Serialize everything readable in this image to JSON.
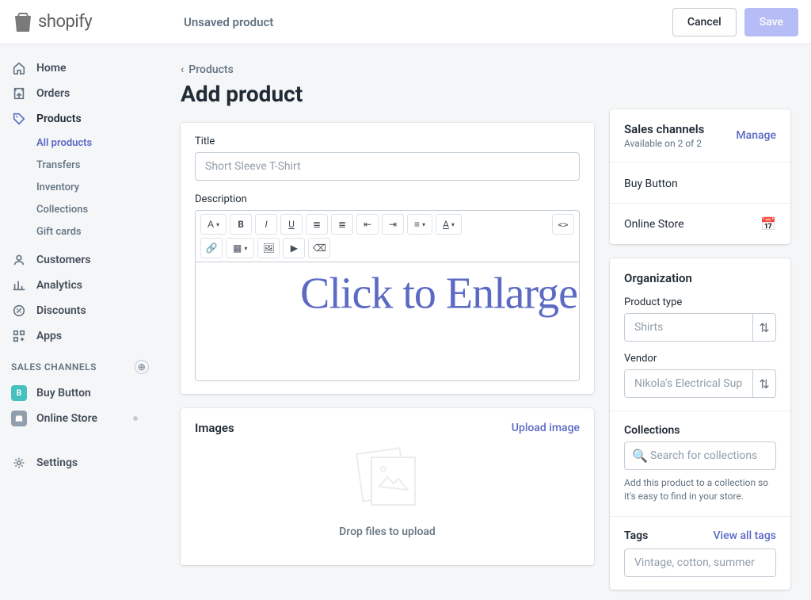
{
  "brand": "shopify",
  "topbar": {
    "title": "Unsaved product",
    "cancel": "Cancel",
    "save": "Save"
  },
  "sidebar": {
    "items": [
      {
        "label": "Home",
        "icon": "home"
      },
      {
        "label": "Orders",
        "icon": "orders"
      },
      {
        "label": "Products",
        "icon": "products",
        "active": true,
        "subs": [
          {
            "label": "All products",
            "selected": true
          },
          {
            "label": "Transfers"
          },
          {
            "label": "Inventory"
          },
          {
            "label": "Collections"
          },
          {
            "label": "Gift cards"
          }
        ]
      },
      {
        "label": "Customers",
        "icon": "customers"
      },
      {
        "label": "Analytics",
        "icon": "analytics"
      },
      {
        "label": "Discounts",
        "icon": "discounts"
      },
      {
        "label": "Apps",
        "icon": "apps"
      }
    ],
    "channelsHeader": "SALES CHANNELS",
    "channels": [
      {
        "label": "Buy Button",
        "color": "#47c1bf"
      },
      {
        "label": "Online Store",
        "color": "#919eab",
        "pin": true
      }
    ],
    "settings": "Settings"
  },
  "breadcrumb": "Products",
  "pageTitle": "Add product",
  "product": {
    "titleLabel": "Title",
    "titlePlaceholder": "Short Sleeve T-Shirt",
    "descLabel": "Description"
  },
  "images": {
    "heading": "Images",
    "uploadLink": "Upload image",
    "dropText": "Drop files to upload"
  },
  "sales": {
    "heading": "Sales channels",
    "manage": "Manage",
    "available": "Available on 2 of 2",
    "rows": [
      "Buy Button",
      "Online Store"
    ]
  },
  "org": {
    "heading": "Organization",
    "typeLabel": "Product type",
    "typePlaceholder": "Shirts",
    "vendorLabel": "Vendor",
    "vendorPlaceholder": "Nikola's Electrical Supplies",
    "collectionsLabel": "Collections",
    "collectionsPlaceholder": "Search for collections",
    "collectionsHelp": "Add this product to a collection so it's easy to find in your store.",
    "tagsLabel": "Tags",
    "tagsLink": "View all tags",
    "tagsPlaceholder": "Vintage, cotton, summer"
  },
  "overlay": "Click to Enlarge"
}
